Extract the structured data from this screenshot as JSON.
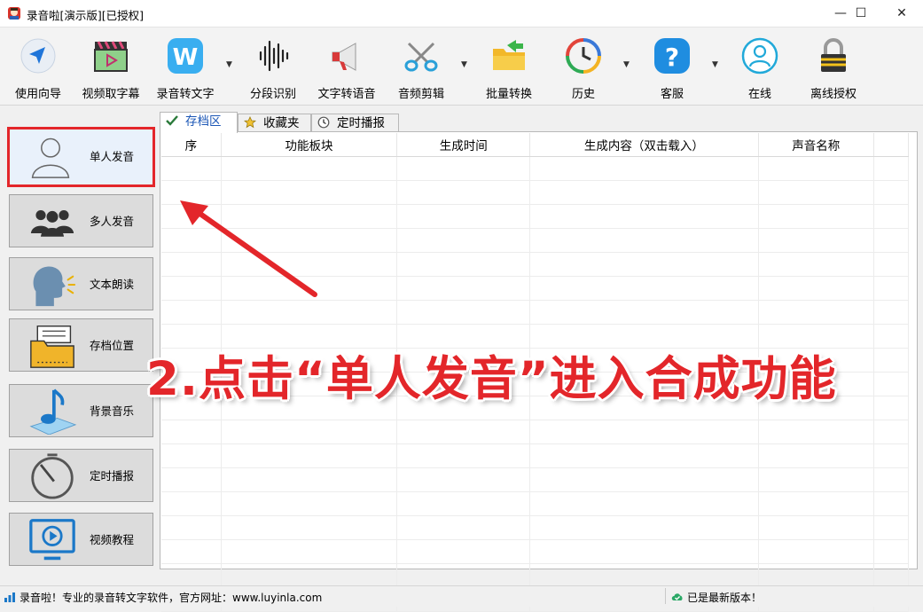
{
  "window": {
    "title": "录音啦[演示版][已授权]",
    "controls": {
      "minimize": "—",
      "maximize": "☐",
      "close": "✕"
    }
  },
  "toolbar": {
    "items": [
      {
        "label": "使用向导",
        "icon": "navigation-arrow-icon"
      },
      {
        "label": "视频取字幕",
        "icon": "video-clapper-icon"
      },
      {
        "label": "录音转文字",
        "icon": "word-w-icon",
        "dropdown": true
      },
      {
        "label": "分段识别",
        "icon": "waveform-icon"
      },
      {
        "label": "文字转语音",
        "icon": "megaphone-icon"
      },
      {
        "label": "音频剪辑",
        "icon": "scissors-icon",
        "dropdown": true
      },
      {
        "label": "批量转换",
        "icon": "folder-arrow-icon"
      },
      {
        "label": "历史",
        "icon": "history-clock-icon",
        "dropdown": true
      },
      {
        "label": "客服",
        "icon": "help-question-icon",
        "dropdown": true
      },
      {
        "label": "在线",
        "icon": "user-online-icon"
      },
      {
        "label": "离线授权",
        "icon": "padlock-icon"
      }
    ]
  },
  "sidebar": {
    "items": [
      {
        "label": "单人发音",
        "icon": "single-person-icon",
        "active": true
      },
      {
        "label": "多人发音",
        "icon": "group-people-icon"
      },
      {
        "label": "文本朗读",
        "icon": "speaking-head-icon"
      },
      {
        "label": "存档位置",
        "icon": "archive-folder-icon"
      },
      {
        "label": "背景音乐",
        "icon": "music-note-icon"
      },
      {
        "label": "定时播报",
        "icon": "timer-icon"
      },
      {
        "label": "视频教程",
        "icon": "video-play-icon"
      }
    ]
  },
  "tabs": [
    {
      "label": "存档区",
      "icon": "checkmark-icon",
      "active": true
    },
    {
      "label": "收藏夹",
      "icon": "star-icon"
    },
    {
      "label": "定时播报",
      "icon": "clock-icon"
    }
  ],
  "table": {
    "columns": [
      "序",
      "功能板块",
      "生成时间",
      "生成内容（双击载入）",
      "声音名称"
    ]
  },
  "annotation": {
    "text": "2.点击“单人发音”进入合成功能"
  },
  "statusbar": {
    "left": "录音啦！专业的录音转文字软件，官方网址：www.luyinla.com",
    "right": "已是最新版本！"
  },
  "colors": {
    "accent_red": "#e3262a",
    "tab_active_text": "#1c57b6",
    "window_bg": "#f0f0f0"
  }
}
